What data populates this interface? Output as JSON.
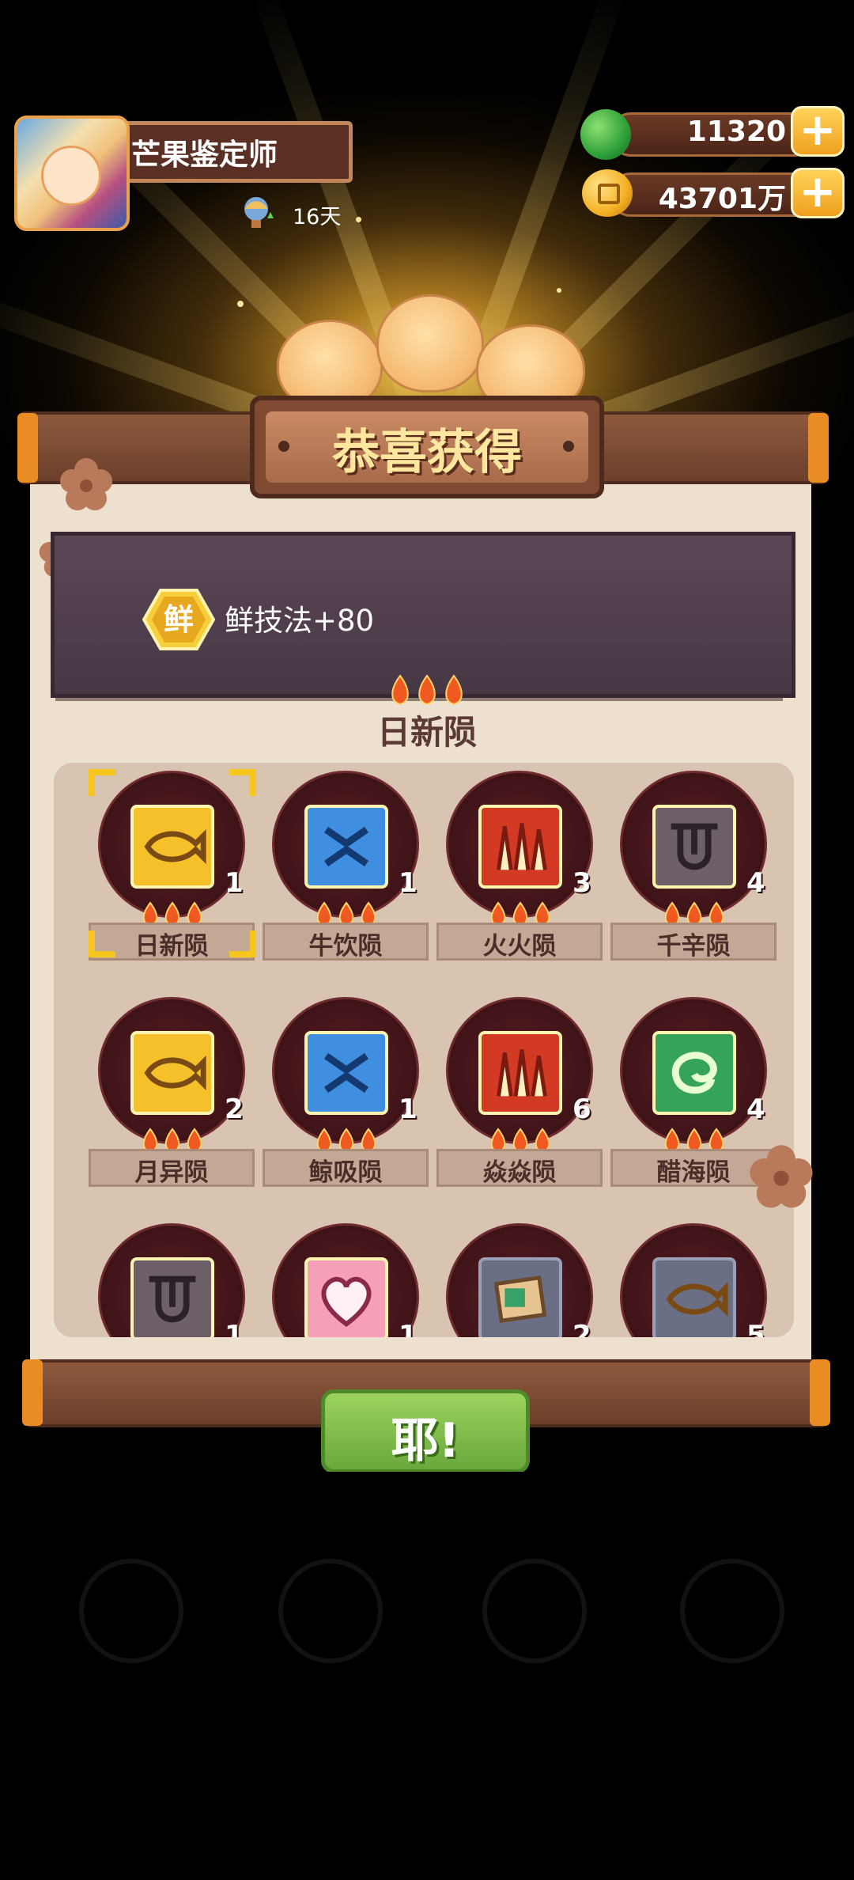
{
  "player": {
    "name": "芒果鉴定师",
    "days": "16天"
  },
  "currency": {
    "green_amount": "11320",
    "gold_amount": "43701万"
  },
  "dialog": {
    "title": "恭喜获得",
    "reward_badge": "鲜",
    "reward_text": "鲜技法+80",
    "rarity_name": "日新陨",
    "confirm_label": "耶!"
  },
  "items": [
    {
      "label": "日新陨",
      "count": "1",
      "color": "gold",
      "glyph": "fish-icon",
      "selected": true
    },
    {
      "label": "牛饮陨",
      "count": "1",
      "color": "blue",
      "glyph": "cross-face-icon"
    },
    {
      "label": "火火陨",
      "count": "3",
      "color": "red",
      "glyph": "flame-bars-icon"
    },
    {
      "label": "千辛陨",
      "count": "4",
      "color": "gray",
      "glyph": "tongue-icon"
    },
    {
      "label": "月异陨",
      "count": "2",
      "color": "gold",
      "glyph": "fish-icon"
    },
    {
      "label": "鲸吸陨",
      "count": "1",
      "color": "blue",
      "glyph": "cross-face-icon"
    },
    {
      "label": "焱焱陨",
      "count": "6",
      "color": "red",
      "glyph": "flame-bars-icon"
    },
    {
      "label": "醋海陨",
      "count": "4",
      "color": "green",
      "glyph": "swirl-icon"
    },
    {
      "label": "",
      "count": "1",
      "color": "gray",
      "glyph": "tongue-icon"
    },
    {
      "label": "",
      "count": "1",
      "color": "pink",
      "glyph": "heart-icon"
    },
    {
      "label": "",
      "count": "2",
      "color": "slate",
      "glyph": "map-icon"
    },
    {
      "label": "",
      "count": "5",
      "color": "slate",
      "glyph": "fish-icon"
    }
  ],
  "colors": {
    "gold": "#f6c02a",
    "blue": "#3f8ee0",
    "red": "#d23a24",
    "gray": "#6e6068",
    "green": "#35a35a",
    "pink": "#f6a0b8",
    "slate": "#6b6f86"
  }
}
